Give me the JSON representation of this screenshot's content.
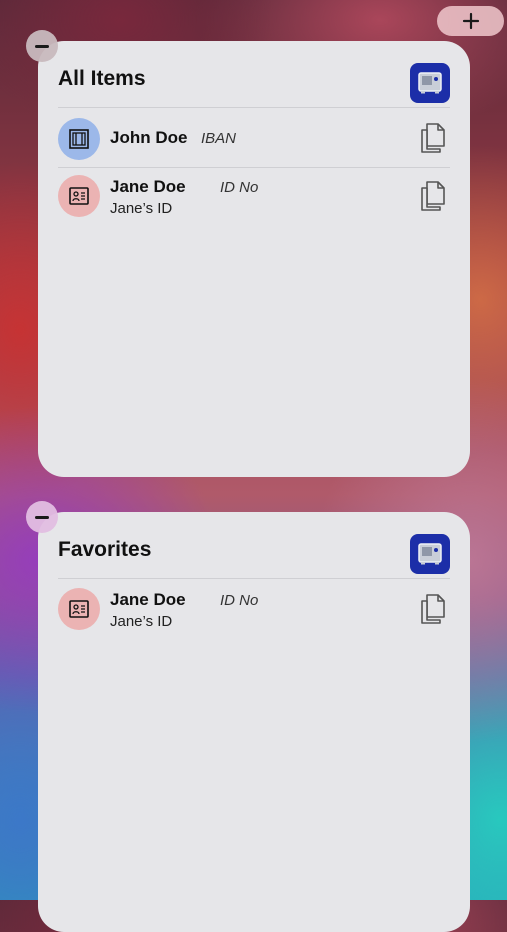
{
  "add_widget": {
    "icon": "plus-icon"
  },
  "widgets": [
    {
      "title": "All Items",
      "logo_icon": "vault-app-icon",
      "items": [
        {
          "name": "John Doe",
          "type": "IBAN",
          "subtitle": "",
          "icon": "bank-card-icon",
          "avatar_color": "#9cb8e9"
        },
        {
          "name": "Jane Doe",
          "type": "ID No",
          "subtitle": "Jane’s ID",
          "icon": "id-card-icon",
          "avatar_color": "#ebb3b3"
        }
      ]
    },
    {
      "title": "Favorites",
      "logo_icon": "vault-app-icon",
      "items": [
        {
          "name": "Jane Doe",
          "type": "ID No",
          "subtitle": "Jane’s ID",
          "icon": "id-card-icon",
          "avatar_color": "#ebb3b3"
        }
      ]
    }
  ],
  "colors": {
    "accent": "#1c2ea8",
    "widget_bg": "#e6e6e9"
  }
}
